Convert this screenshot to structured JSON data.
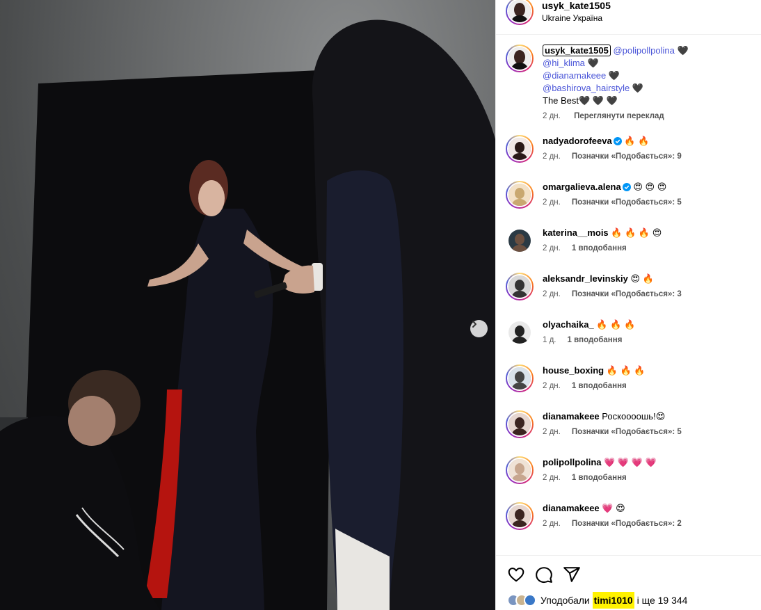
{
  "post": {
    "author": "usyk_kate1505",
    "location": "Ukraine Україна"
  },
  "caption": {
    "user": "usyk_kate1505",
    "lines": [
      {
        "mention": "@polipollpolina",
        "emoji": "🖤"
      },
      {
        "mention": "@hi_klima",
        "emoji": "🖤"
      },
      {
        "mention": "@dianamakeee",
        "emoji": "🖤"
      },
      {
        "mention": "@bashirova_hairstyle",
        "emoji": "🖤"
      }
    ],
    "tail": "The Best🖤 🖤 🖤",
    "time": "2 дн.",
    "translate": "Переглянути переклад"
  },
  "comments": [
    {
      "user": "nadyadorofeeva",
      "verified": true,
      "text": "🔥 🔥",
      "time": "2 дн.",
      "likes": "Позначки «Подобається»: 9"
    },
    {
      "user": "omargalieva.alena",
      "verified": true,
      "text": "😍 😍 😍",
      "time": "2 дн.",
      "likes": "Позначки «Подобається»: 5"
    },
    {
      "user": "katerina__mois",
      "verified": false,
      "text": "🔥 🔥 🔥 😍",
      "time": "2 дн.",
      "likes": "1 вподобання"
    },
    {
      "user": "aleksandr_levinskiy",
      "verified": false,
      "text": "😍 🔥",
      "time": "2 дн.",
      "likes": "Позначки «Подобається»: 3"
    },
    {
      "user": "olyachaika_",
      "verified": false,
      "text": "🔥 🔥 🔥",
      "time": "1 д.",
      "likes": "1 вподобання"
    },
    {
      "user": "house_boxing",
      "verified": false,
      "text": "🔥 🔥 🔥",
      "time": "2 дн.",
      "likes": "1 вподобання"
    },
    {
      "user": "dianamakeee",
      "verified": false,
      "text": "Роскоооошь!😍",
      "time": "2 дн.",
      "likes": "Позначки «Подобається»: 5"
    },
    {
      "user": "polipollpolina",
      "verified": false,
      "text": "💗 💗 💗 💗",
      "time": "2 дн.",
      "likes": "1 вподобання"
    },
    {
      "user": "dianamakeee",
      "verified": false,
      "text": "💗 😍",
      "time": "2 дн.",
      "likes": "Позначки «Подобається»: 2"
    }
  ],
  "likes": {
    "prefix": "Уподобали",
    "user": "timi1010",
    "suffix": "і ще 19 344"
  },
  "icons": {
    "like": "heart-icon",
    "comment": "comment-icon",
    "share": "share-icon",
    "next": "chevron-right-icon",
    "verified": "verified-badge-icon"
  },
  "colors": {
    "mention": "#4a55d8",
    "verified": "#0095f6",
    "highlight": "#fff200"
  }
}
